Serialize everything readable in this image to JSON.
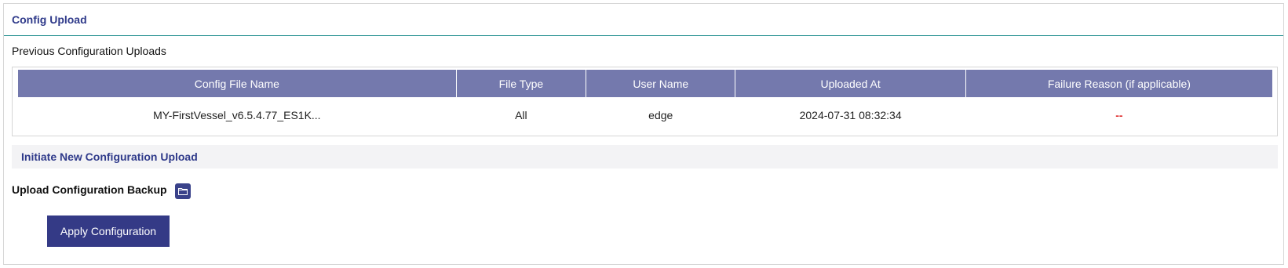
{
  "panel": {
    "title": "Config Upload"
  },
  "previous": {
    "label": "Previous Configuration Uploads",
    "columns": [
      "Config File Name",
      "File Type",
      "User Name",
      "Uploaded At",
      "Failure Reason (if applicable)"
    ],
    "rows": [
      {
        "file_name": "MY-FirstVessel_v6.5.4.77_ES1K...",
        "file_type": "All",
        "user_name": "edge",
        "uploaded_at": "2024-07-31 08:32:34",
        "failure_reason": "--"
      }
    ]
  },
  "initiate": {
    "title": "Initiate New Configuration Upload",
    "upload_label": "Upload Configuration Backup",
    "upload_icon": "folder-icon",
    "apply_label": "Apply Configuration"
  },
  "colors": {
    "accent": "#2f3a8a",
    "header_bg": "#7479ad",
    "button_bg": "#343a86",
    "divider": "#1e8c8c",
    "failure_text": "#e03030"
  }
}
